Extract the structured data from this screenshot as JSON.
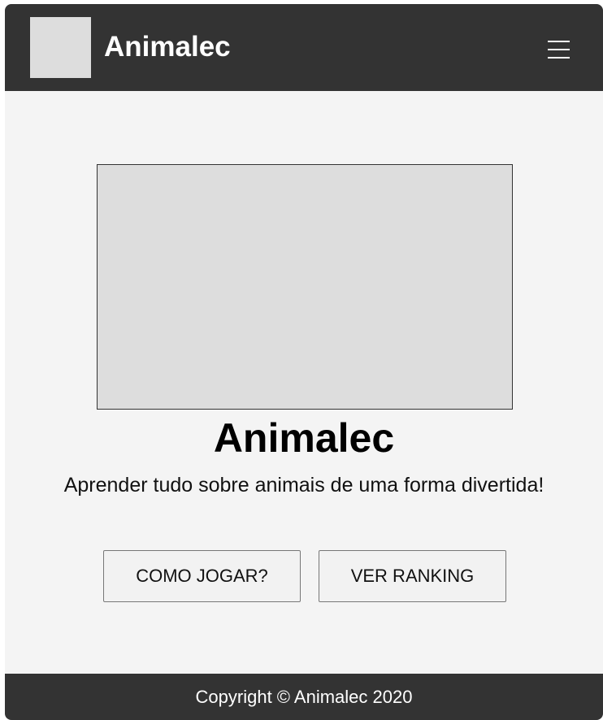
{
  "header": {
    "brand": "Animalec",
    "menu_icon": "hamburger-menu-icon"
  },
  "hero": {
    "title": "Animalec",
    "subtitle": "Aprender tudo sobre animais de uma forma divertida!"
  },
  "actions": {
    "how_to_play": "COMO JOGAR?",
    "ranking": "VER RANKING"
  },
  "footer": {
    "copyright": "Copyright © Animalec 2020"
  },
  "colors": {
    "header_bg": "#333333",
    "page_bg": "#f4f4f4",
    "placeholder": "#dddddd",
    "text_light": "#ffffff"
  }
}
